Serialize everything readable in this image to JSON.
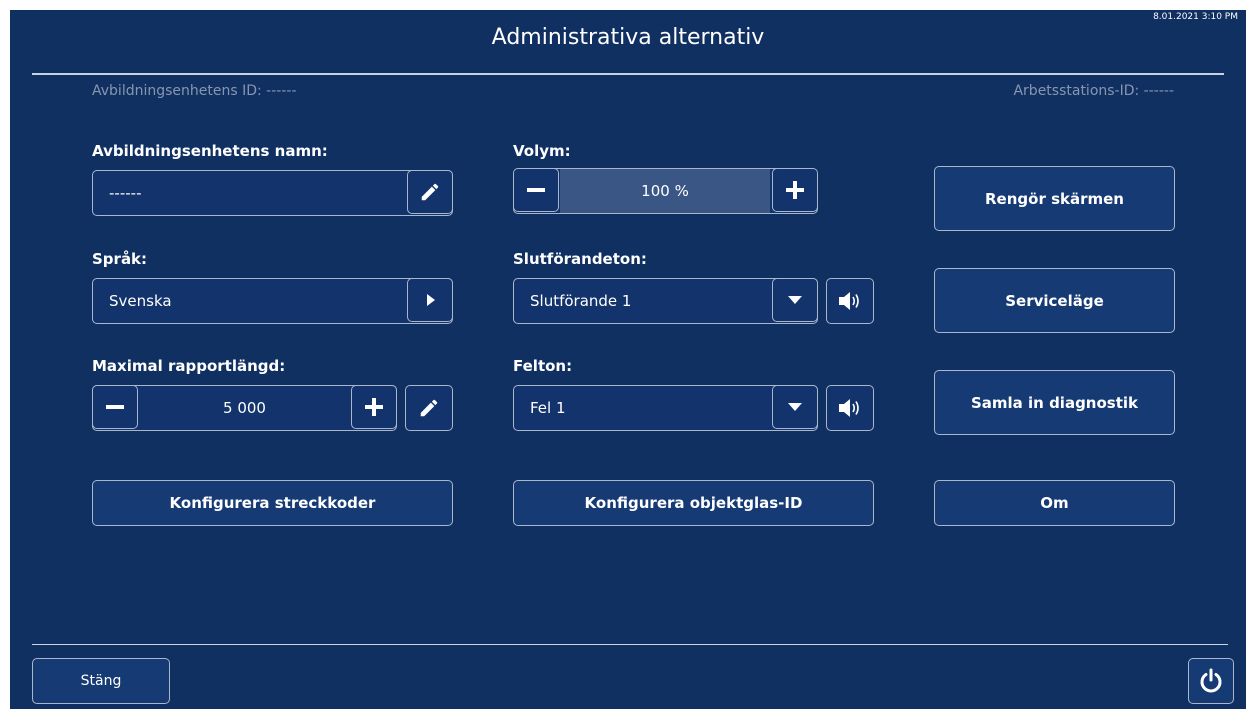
{
  "header": {
    "title": "Administrativa alternativ",
    "datetime": "8.01.2021 3:10 PM"
  },
  "info": {
    "device_id": "Avbildningsenhetens ID: ------",
    "workstation_id": "Arbetsstations-ID: ------"
  },
  "device_name": {
    "label": "Avbildningsenhetens namn:",
    "value": "------"
  },
  "language": {
    "label": "Språk:",
    "value": "Svenska"
  },
  "max_report_length": {
    "label": "Maximal rapportlängd:",
    "value": "5 000"
  },
  "volume": {
    "label": "Volym:",
    "value": "100 %",
    "level": 0.5
  },
  "completion_tone": {
    "label": "Slutförandeton:",
    "value": "Slutförande 1"
  },
  "error_tone": {
    "label": "Felton:",
    "value": "Fel 1"
  },
  "buttons": {
    "configure_barcodes": "Konfigurera streckkoder",
    "configure_slide_id": "Konfigurera objektglas-ID",
    "clean_screen": "Rengör skärmen",
    "service_mode": "Serviceläge",
    "collect_diagnostics": "Samla in diagnostik",
    "about": "Om"
  },
  "footer": {
    "close": "Stäng"
  },
  "icons": [
    "pencil-icon",
    "play-arrow-icon",
    "chevron-down-icon",
    "speaker-icon",
    "power-icon",
    "minus-icon",
    "plus-icon"
  ],
  "colors": {
    "background": "#103062",
    "border": "#aab6c9",
    "volume_fill": "#3a5685"
  }
}
